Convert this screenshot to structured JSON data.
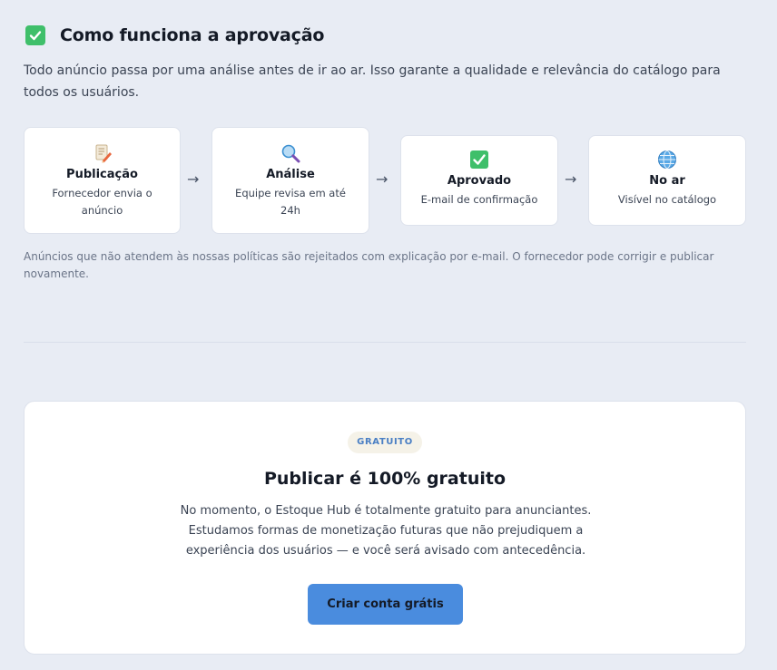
{
  "header": {
    "icon": "check-mark-icon",
    "title": "Como funciona a aprovação"
  },
  "intro": "Todo anúncio passa por uma análise antes de ir ao ar. Isso garante a qualidade e relevância do catálogo para todos os usuários.",
  "steps": [
    {
      "icon": "memo-pencil-icon",
      "title": "Publicação",
      "desc": "Fornecedor envia o anúncio"
    },
    {
      "icon": "magnifier-icon",
      "title": "Análise",
      "desc": "Equipe revisa em até 24h"
    },
    {
      "icon": "check-mark-icon",
      "title": "Aprovado",
      "desc": "E-mail de confirmação"
    },
    {
      "icon": "globe-icon",
      "title": "No ar",
      "desc": "Visível no catálogo"
    }
  ],
  "arrow": "→",
  "footnote": "Anúncios que não atendem às nossas políticas são rejeitados com explicação por e-mail. O fornecedor pode corrigir e publicar novamente.",
  "pricing": {
    "badge": "GRATUITO",
    "title": "Publicar é 100% gratuito",
    "text": "No momento, o Estoque Hub é totalmente gratuito para anunciantes. Estudamos formas de monetização futuras que não prejudiquem a experiência dos usuários — e você será avisado com antecedência.",
    "cta": "Criar conta grátis"
  },
  "colors": {
    "background": "#e8ecf4",
    "accent": "#4a8cde",
    "success": "#3fbf6a"
  }
}
